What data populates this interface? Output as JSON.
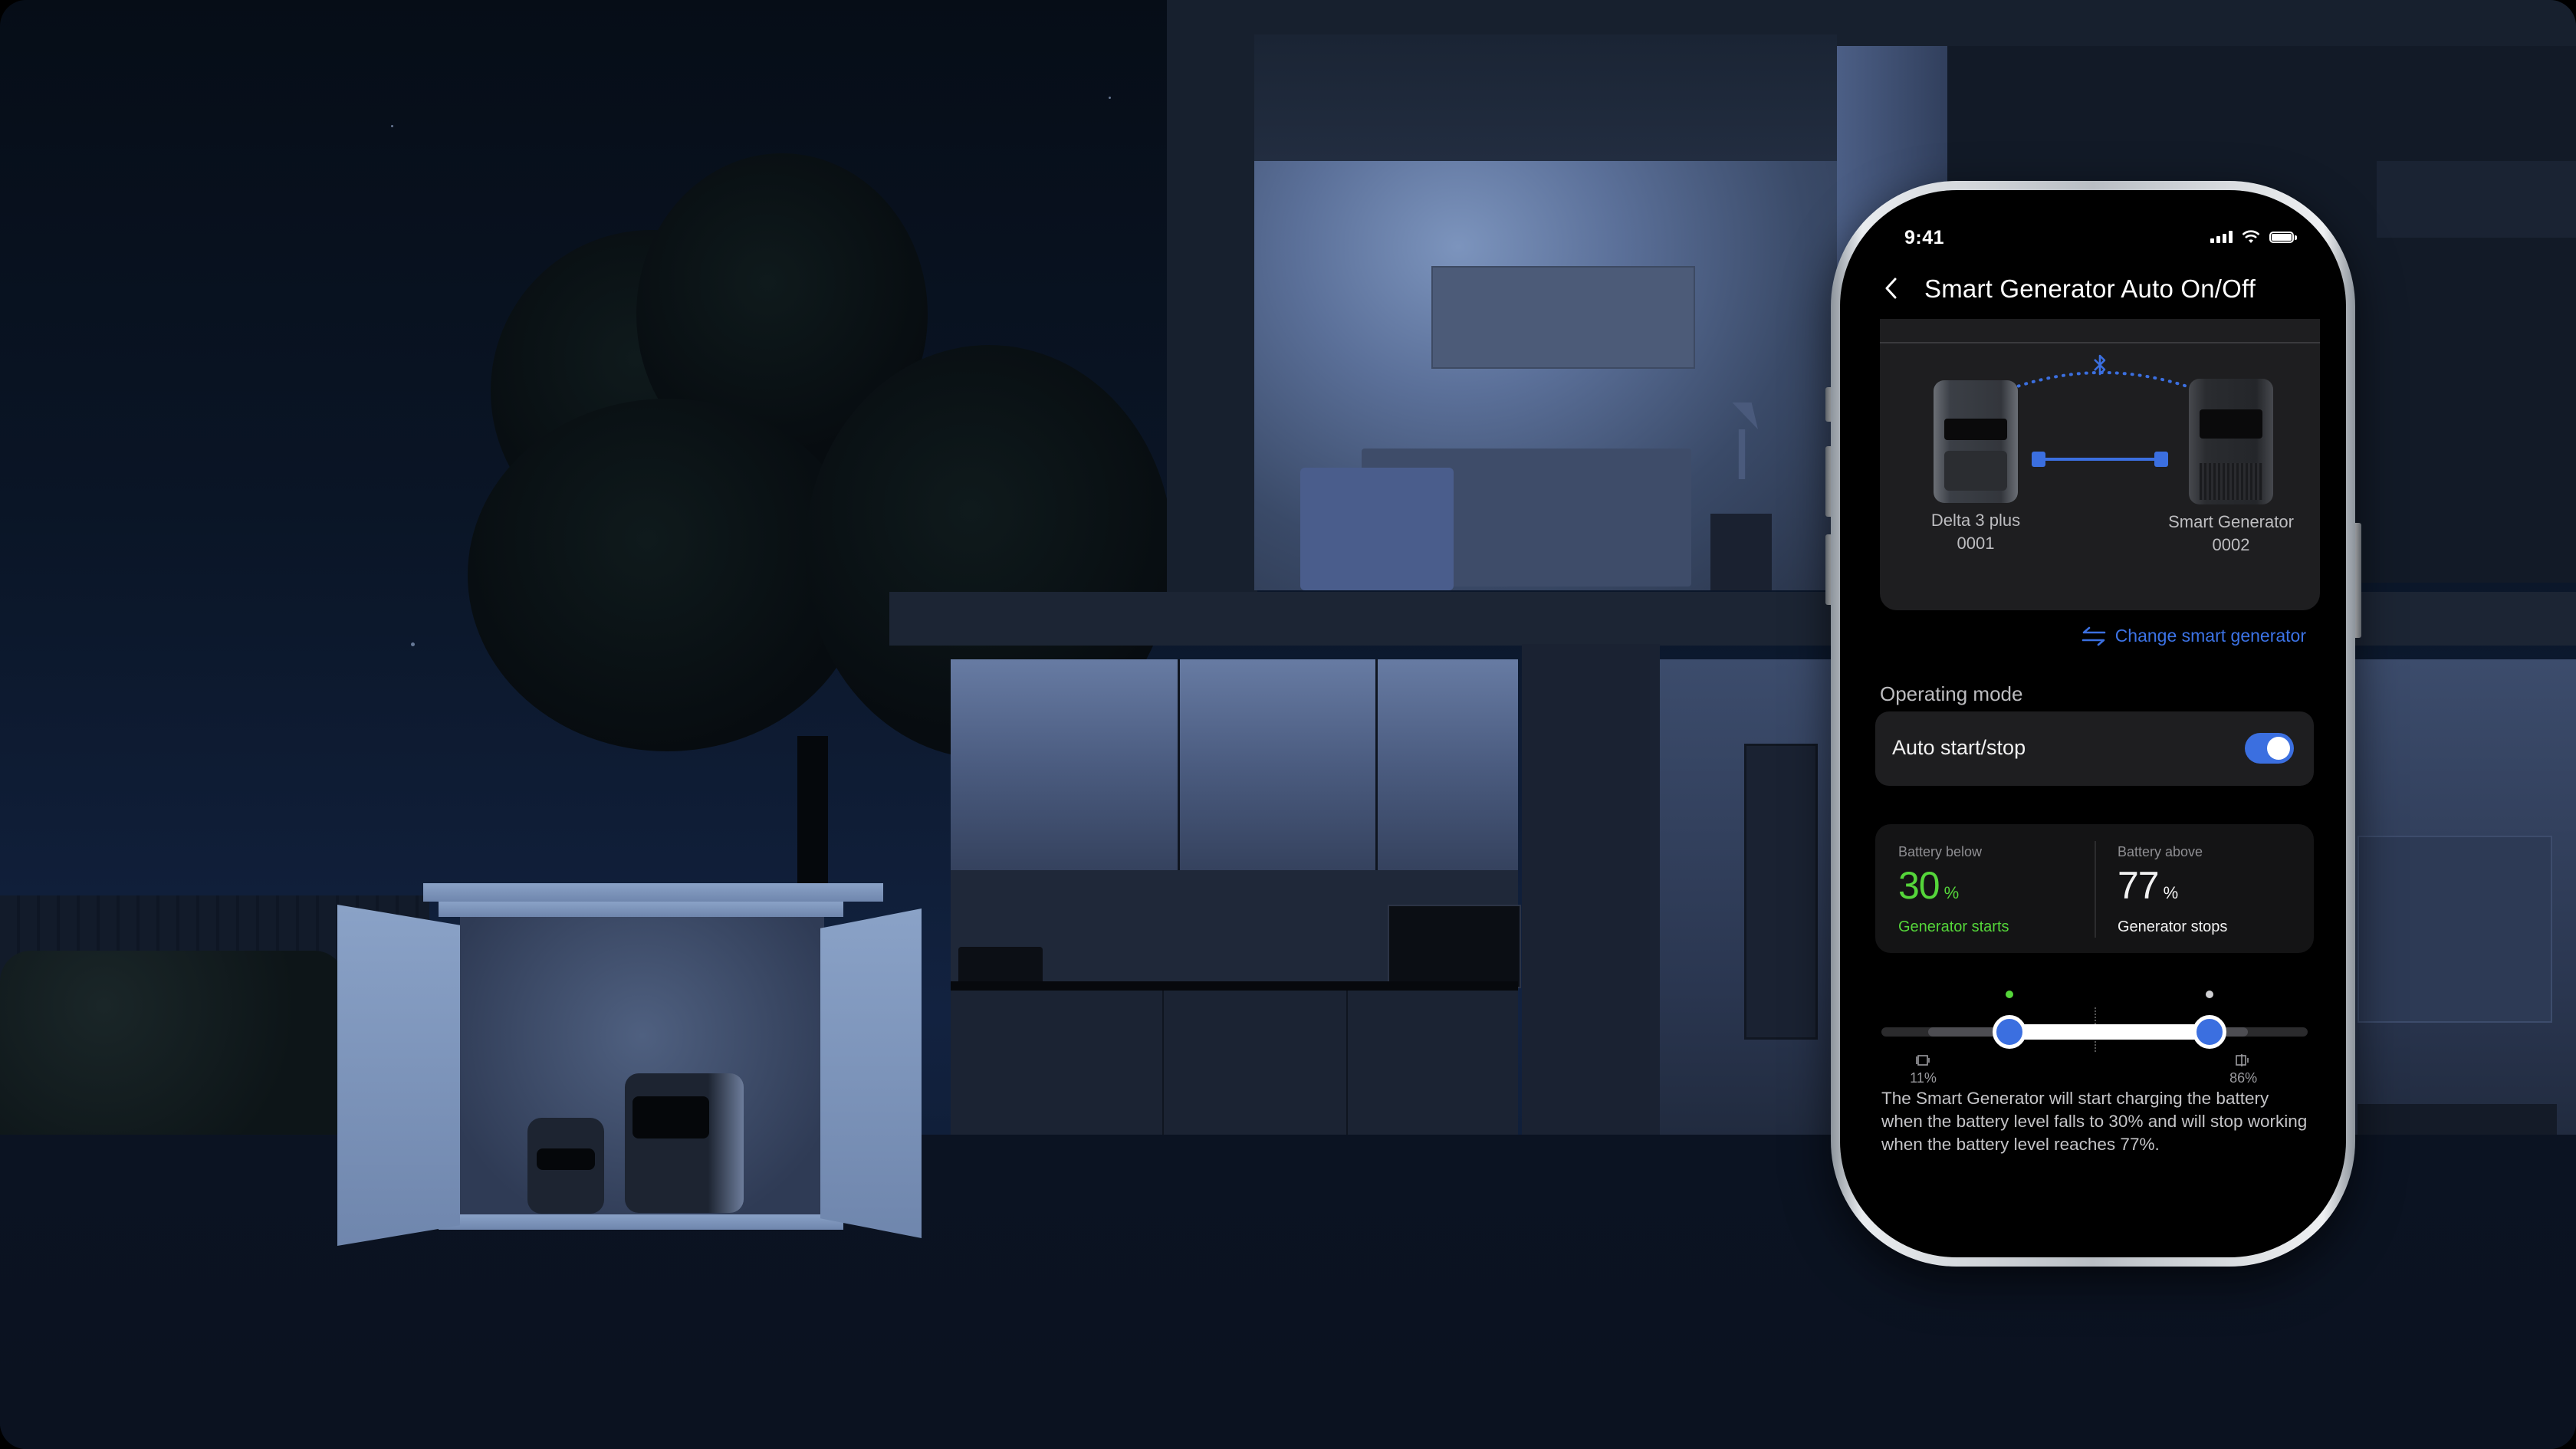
{
  "status_bar": {
    "time": "9:41",
    "icons": [
      "signal-icon",
      "wifi-icon",
      "battery-icon"
    ]
  },
  "header": {
    "back_icon": "chevron-left-icon",
    "title": "Smart Generator Auto On/Off"
  },
  "devices": {
    "link_icon": "bluetooth-icon",
    "connection": "cable",
    "items": [
      {
        "name": "Delta 3 plus",
        "id": "0001"
      },
      {
        "name": "Smart Generator",
        "id": "0002"
      }
    ]
  },
  "change_link": {
    "icon": "swap-arrows-icon",
    "label": "Change smart generator"
  },
  "operating_mode": {
    "section_label": "Operating mode",
    "auto_label": "Auto start/stop",
    "auto_enabled": true
  },
  "thresholds": {
    "start": {
      "caption": "Battery below",
      "value": "30",
      "unit": "%",
      "status": "Generator starts",
      "color": "#55d63a"
    },
    "stop": {
      "caption": "Battery above",
      "value": "77",
      "unit": "%",
      "status": "Generator stops",
      "color": "#f2f2f2"
    }
  },
  "slider": {
    "min_percent": 0,
    "max_percent": 100,
    "allowed_range": [
      11,
      86
    ],
    "start_value": 30,
    "stop_value": 77,
    "min_label": "11%",
    "max_label": "86%",
    "low_icon": "battery-low-icon",
    "high_icon": "battery-high-icon"
  },
  "description": "The Smart Generator will start charging the battery when the battery level falls to 30% and will stop working when the battery level reaches 77%.",
  "colors": {
    "accent": "#3b6fe0",
    "start_green": "#55d63a",
    "stop_dot": "#cfcfd2"
  }
}
